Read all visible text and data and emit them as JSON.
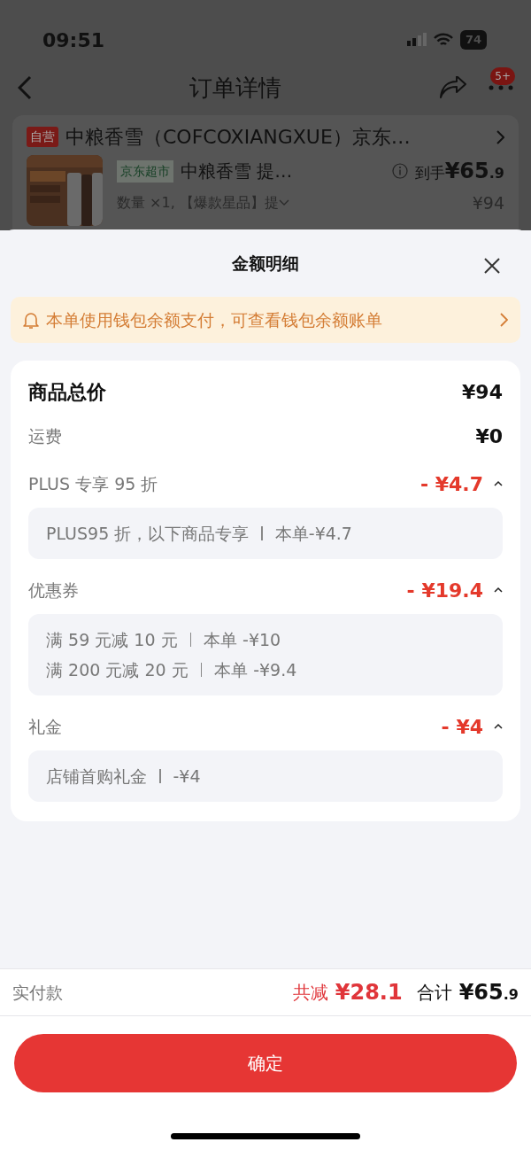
{
  "status_bar": {
    "time": "09:51",
    "battery": "74"
  },
  "header": {
    "title": "订单详情",
    "badge": "5+"
  },
  "order": {
    "shop_tag": "自营",
    "shop_name": "中粮香雪（COFCOXIANGXUE）京东…",
    "store_tag": "京东超市",
    "product_name": "中粮香雪 提…",
    "price_label": "到手",
    "price": {
      "main": "¥65",
      "decimal": ".9"
    },
    "original_price": "¥94",
    "spec": "数量 ×1, 【爆款星品】提"
  },
  "sheet": {
    "title": "金额明细",
    "notice": "本单使用钱包余额支付，可查看钱包余额账单",
    "rows": [
      {
        "kind": "total",
        "label": "商品总价",
        "amount": "¥94"
      },
      {
        "kind": "plain",
        "label": "运费",
        "amount": "¥0"
      },
      {
        "kind": "discount",
        "label": "PLUS 专享 95 折",
        "amount": "- ¥4.7",
        "expanded": true,
        "details": [
          {
            "text": "PLUS95 折，以下商品专享",
            "amount": "本单-¥4.7"
          }
        ]
      },
      {
        "kind": "discount",
        "label": "优惠券",
        "amount": "- ¥19.4",
        "expanded": true,
        "details": [
          {
            "text": "满 59 元减 10 元",
            "amount": "本单 -¥10"
          },
          {
            "text": "满 200 元减 20 元",
            "amount": "本单 -¥9.4"
          }
        ]
      },
      {
        "kind": "discount",
        "label": "礼金",
        "amount": "- ¥4",
        "expanded": true,
        "details": [
          {
            "text": "店铺首购礼金",
            "amount": "-¥4"
          }
        ]
      }
    ]
  },
  "footer": {
    "label": "实付款",
    "reduced_label": "共减",
    "reduced": "¥28.1",
    "total_label": "合计",
    "total": {
      "main": "¥65",
      "decimal": ".9"
    },
    "button": "确定"
  }
}
